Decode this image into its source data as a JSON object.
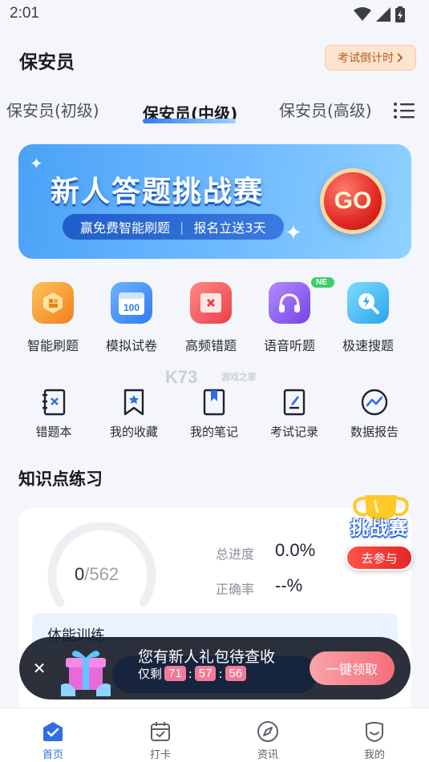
{
  "status_bar": {
    "time": "2:01"
  },
  "header": {
    "title": "保安员",
    "countdown_label": "考试倒计时"
  },
  "tabs": [
    {
      "label": "保安员(初级)",
      "active": false
    },
    {
      "label": "保安员(中级)",
      "active": true
    },
    {
      "label": "保安员(高级)",
      "active": false
    }
  ],
  "banner": {
    "title": "新人答题挑战赛",
    "sub_left": "赢免费智能刷题",
    "sub_right": "报名立送3天",
    "go_label": "GO"
  },
  "features": [
    {
      "label": "智能刷题",
      "icon": "smart-practice-icon",
      "color": "#f59a2c"
    },
    {
      "label": "模拟试卷",
      "icon": "mock-exam-icon",
      "color": "#3d8cf2",
      "icon_text": "100"
    },
    {
      "label": "高频错题",
      "icon": "frequent-mistakes-icon",
      "color": "#f0525a"
    },
    {
      "label": "语音听题",
      "icon": "headphones-icon",
      "color": "#8a5cf0",
      "badge": "NE"
    },
    {
      "label": "极速搜题",
      "icon": "quick-search-icon",
      "color": "#3fb6f0"
    }
  ],
  "tools": [
    {
      "label": "错题本",
      "icon": "mistake-book-icon"
    },
    {
      "label": "我的收藏",
      "icon": "bookmark-icon"
    },
    {
      "label": "我的笔记",
      "icon": "notebook-icon"
    },
    {
      "label": "考试记录",
      "icon": "exam-record-icon"
    },
    {
      "label": "数据报告",
      "icon": "data-report-icon"
    }
  ],
  "watermark": {
    "main": "K73",
    "sub": "游戏之家"
  },
  "knowledge": {
    "section_title": "知识点练习",
    "done": "0",
    "total": "/562",
    "progress_label": "总进度",
    "progress_value": "0.0%",
    "accuracy_label": "正确率",
    "accuracy_value": "--%",
    "first_chapter": "体能训练"
  },
  "challenge": {
    "title": "挑战赛",
    "button": "去参与"
  },
  "gift": {
    "title": "您有新人礼包待查收",
    "prefix": "仅剩",
    "hours": "71",
    "minutes": "57",
    "seconds": "56",
    "sep": ":",
    "claim": "一键领取",
    "close": "✕"
  },
  "bottom_nav": [
    {
      "label": "首页",
      "icon": "home-icon",
      "active": true
    },
    {
      "label": "打卡",
      "icon": "calendar-checkin-icon",
      "active": false
    },
    {
      "label": "资讯",
      "icon": "compass-icon",
      "active": false
    },
    {
      "label": "我的",
      "icon": "profile-icon",
      "active": false
    }
  ],
  "colors": {
    "accent": "#2f6fe4",
    "banner": "#4aa2f7",
    "danger": "#e22727"
  }
}
